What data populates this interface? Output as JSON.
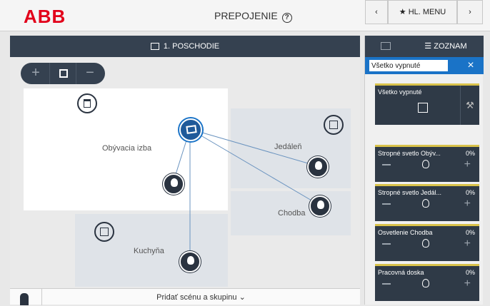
{
  "header": {
    "logo_text": "ABB",
    "title": "PREPOJENIE",
    "help_icon": "?",
    "back_icon": "chevron-left-icon",
    "home_label": "HL. MENU",
    "forward_icon": "chevron-right-icon"
  },
  "floor": {
    "title": "1. POSCHODIE"
  },
  "map": {
    "zoom_in": "+",
    "fit": "fit-icon",
    "zoom_out": "−",
    "rooms": [
      {
        "label": "Obývacia izba"
      },
      {
        "label": "Jedáleň"
      },
      {
        "label": "Chodba"
      },
      {
        "label": "Kuchyňa"
      }
    ]
  },
  "bottom": {
    "add_label": "Pridať scénu a skupinu",
    "chevron": "⌄"
  },
  "right_panel": {
    "list_label": "ZOZNAM",
    "search_value": "Všetko vypnuté",
    "close_icon": "×",
    "scene_card": {
      "name": "Všetko vypnuté"
    },
    "lights": [
      {
        "name": "Stropné svetlo Obýv...",
        "level": "0%"
      },
      {
        "name": "Stropné svetlo Jedál...",
        "level": "0%"
      },
      {
        "name": "Osvetlenie Chodba",
        "level": "0%"
      },
      {
        "name": "Pracovná doska",
        "level": "0%"
      }
    ]
  },
  "colors": {
    "accent_blue": "#1a73c7",
    "dark_panel": "#354150",
    "logo_red": "#e2001a",
    "card_border": "#d9c24a"
  }
}
